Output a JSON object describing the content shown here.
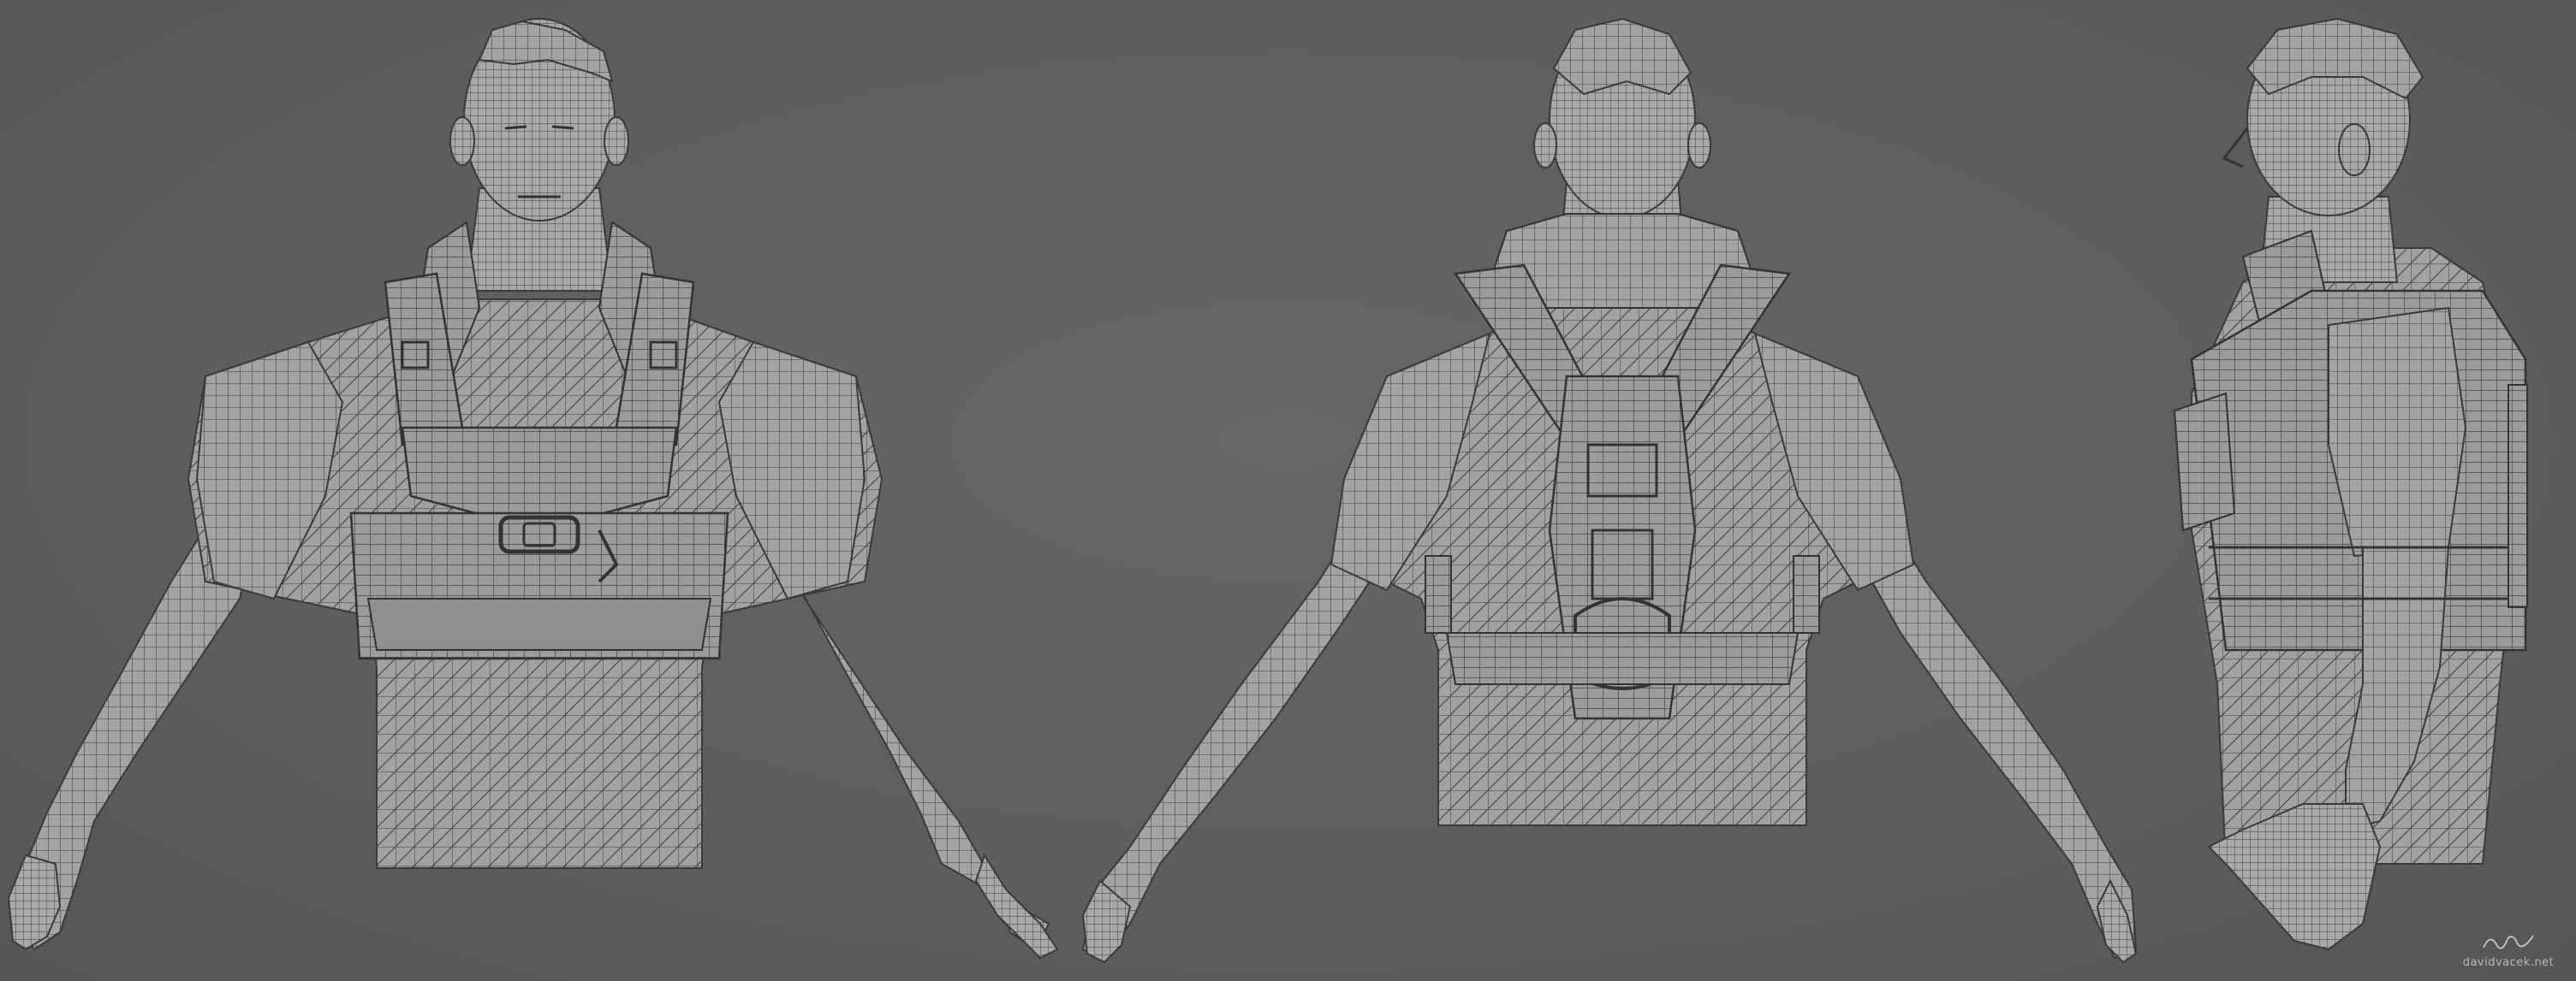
{
  "views": [
    {
      "view": "front"
    },
    {
      "view": "back"
    },
    {
      "view": "side"
    }
  ],
  "colors": {
    "background": "#5e5e5e",
    "model_fill": "#a3a3a3",
    "model_shadow": "#8a8a8a",
    "wire": "#3a3a3a",
    "strap_fill": "#9a9a9a"
  },
  "watermark": {
    "text": "davidvacek.net"
  }
}
